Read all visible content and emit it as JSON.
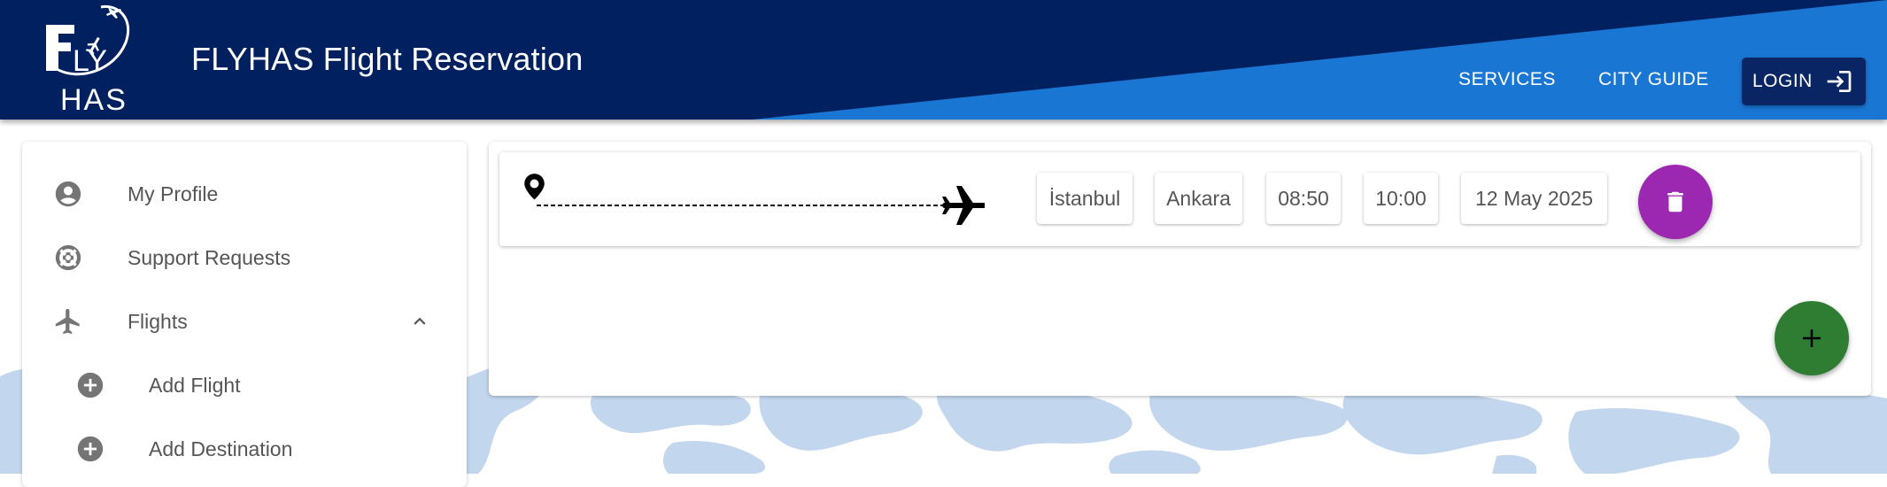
{
  "header": {
    "logo_text": "FLY HAS",
    "app_title": "FLYHAS Flight Reservation",
    "nav": {
      "services": "SERVICES",
      "city_guide": "CITY GUIDE",
      "login": "LOGIN"
    }
  },
  "sidebar": {
    "items": [
      {
        "label": "My Profile",
        "icon": "account-circle-icon"
      },
      {
        "label": "Support Requests",
        "icon": "lifebuoy-icon"
      },
      {
        "label": "Flights",
        "icon": "airplane-icon",
        "expanded": true
      },
      {
        "label": "Add Flight",
        "icon": "add-circle-icon"
      },
      {
        "label": "Add Destination",
        "icon": "add-circle-icon"
      }
    ]
  },
  "flights": [
    {
      "from": "İstanbul",
      "to": "Ankara",
      "departure": "08:50",
      "arrival": "10:00",
      "date": "12 May 2025"
    }
  ],
  "colors": {
    "header_dark": "#002060",
    "header_light": "#1976d2",
    "delete": "#9c27b0",
    "add": "#2e7d32",
    "map": "#c2d6ed"
  }
}
